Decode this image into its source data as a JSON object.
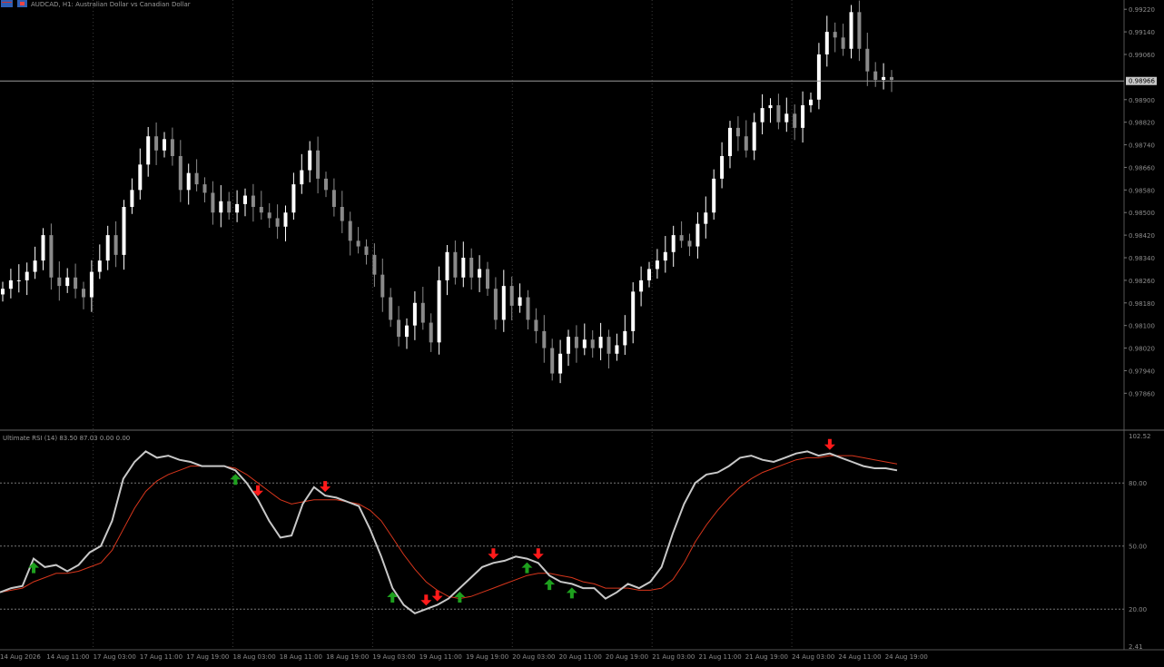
{
  "header": {
    "symbol_text": "AUDCAD, H1:  Australian Dollar vs Canadian Dollar"
  },
  "indicator_header": {
    "text": "Ultimate RSI (14) 83.50 87.03 0.00 0.00"
  },
  "price_axis": {
    "ticks": [
      "0.99220",
      "0.99140",
      "0.99060",
      "0.98900",
      "0.98820",
      "0.98740",
      "0.98660",
      "0.98580",
      "0.98500",
      "0.98420",
      "0.98340",
      "0.98260",
      "0.98180",
      "0.98100",
      "0.98020",
      "0.97940",
      "0.97860"
    ],
    "current_label": "0.98966"
  },
  "indicator_axis": {
    "ticks": [
      "102.52",
      "80.00",
      "50.00",
      "20.00",
      "2.41"
    ]
  },
  "time_axis": {
    "ticks": [
      "14 Aug 2026",
      "14 Aug 11:00",
      "17 Aug 03:00",
      "17 Aug 11:00",
      "17 Aug 19:00",
      "18 Aug 03:00",
      "18 Aug 11:00",
      "18 Aug 19:00",
      "19 Aug 03:00",
      "19 Aug 11:00",
      "19 Aug 19:00",
      "20 Aug 03:00",
      "20 Aug 11:00",
      "20 Aug 19:00",
      "21 Aug 03:00",
      "21 Aug 11:00",
      "21 Aug 19:00",
      "24 Aug 03:00",
      "24 Aug 11:00",
      "24 Aug 19:00"
    ]
  },
  "colors": {
    "background": "#000000",
    "bull": "#ffffff",
    "bear": "#8a8a8a",
    "rsi_line": "#c8c8c8",
    "signal_line": "#d8361c",
    "buy_arrow": "#1ea01e",
    "sell_arrow": "#ff1a1a",
    "grid": "#3a3a3a"
  },
  "chart_data": [
    {
      "type": "candlestick",
      "title": "AUDCAD, H1:  Australian Dollar vs Canadian Dollar",
      "ylim": [
        0.978,
        0.9924
      ],
      "current_price": 0.98966,
      "close_path": [
        0.9823,
        0.9826,
        0.9826,
        0.9829,
        0.9833,
        0.9842,
        0.9827,
        0.9824,
        0.9827,
        0.9823,
        0.982,
        0.9829,
        0.9833,
        0.9842,
        0.9835,
        0.9852,
        0.9858,
        0.9867,
        0.9877,
        0.9872,
        0.9876,
        0.987,
        0.9858,
        0.9864,
        0.986,
        0.9857,
        0.985,
        0.9854,
        0.985,
        0.9853,
        0.9856,
        0.9852,
        0.985,
        0.9848,
        0.9845,
        0.985,
        0.986,
        0.9865,
        0.9872,
        0.9862,
        0.9858,
        0.9852,
        0.9847,
        0.984,
        0.9838,
        0.9835,
        0.9828,
        0.982,
        0.9812,
        0.9806,
        0.981,
        0.9818,
        0.9811,
        0.9804,
        0.9826,
        0.9836,
        0.9827,
        0.9834,
        0.9827,
        0.983,
        0.9823,
        0.9812,
        0.9824,
        0.9817,
        0.982,
        0.9812,
        0.9808,
        0.9802,
        0.9793,
        0.98,
        0.9806,
        0.9802,
        0.9805,
        0.9802,
        0.9806,
        0.98,
        0.9803,
        0.9808,
        0.9822,
        0.9826,
        0.983,
        0.9833,
        0.9836,
        0.9842,
        0.984,
        0.9838,
        0.9846,
        0.985,
        0.9862,
        0.987,
        0.988,
        0.9877,
        0.9872,
        0.9882,
        0.9887,
        0.9888,
        0.9882,
        0.9885,
        0.988,
        0.9888,
        0.989,
        0.9906,
        0.9914,
        0.9912,
        0.9908,
        0.9921,
        0.9908,
        0.99,
        0.9897,
        0.9898,
        0.9897
      ]
    },
    {
      "type": "line",
      "title": "Ultimate RSI (14) 83.50 87.03 0.00 0.00",
      "ylim": [
        2.41,
        102.52
      ],
      "levels": [
        80,
        50,
        20
      ],
      "series": [
        {
          "values": [
            28,
            30,
            31,
            44,
            40,
            41,
            38,
            41,
            47,
            50,
            62,
            82,
            90,
            95,
            92,
            93,
            91,
            90,
            88,
            88,
            88,
            86,
            80,
            72,
            62,
            54,
            55,
            70,
            78,
            74,
            73,
            71,
            69,
            58,
            45,
            30,
            22,
            18,
            20,
            22,
            25,
            30,
            35,
            40,
            42,
            43,
            45,
            44,
            42,
            36,
            33,
            32,
            30,
            30,
            25,
            28,
            32,
            30,
            33,
            40,
            56,
            70,
            80,
            84,
            85,
            88,
            92,
            93,
            91,
            90,
            92,
            94,
            95,
            93,
            94,
            92,
            90,
            88,
            87,
            87,
            86
          ]
        },
        {
          "values": [
            28,
            29,
            30,
            33,
            35,
            37,
            37,
            38,
            40,
            42,
            48,
            58,
            68,
            76,
            81,
            84,
            86,
            88,
            88,
            88,
            88,
            87,
            84,
            80,
            76,
            72,
            70,
            71,
            72,
            72,
            72,
            71,
            70,
            67,
            62,
            54,
            46,
            39,
            33,
            29,
            26,
            25,
            26,
            28,
            30,
            32,
            34,
            36,
            37,
            37,
            36,
            35,
            33,
            32,
            30,
            30,
            30,
            29,
            29,
            30,
            34,
            42,
            52,
            60,
            67,
            73,
            78,
            82,
            85,
            87,
            89,
            91,
            92,
            92,
            93,
            93,
            93,
            92,
            91,
            90,
            89
          ]
        }
      ],
      "buy_signals": [
        3,
        21,
        35,
        41,
        47,
        49,
        51
      ],
      "sell_signals": [
        23,
        29,
        38,
        39,
        44,
        48,
        74
      ]
    }
  ]
}
